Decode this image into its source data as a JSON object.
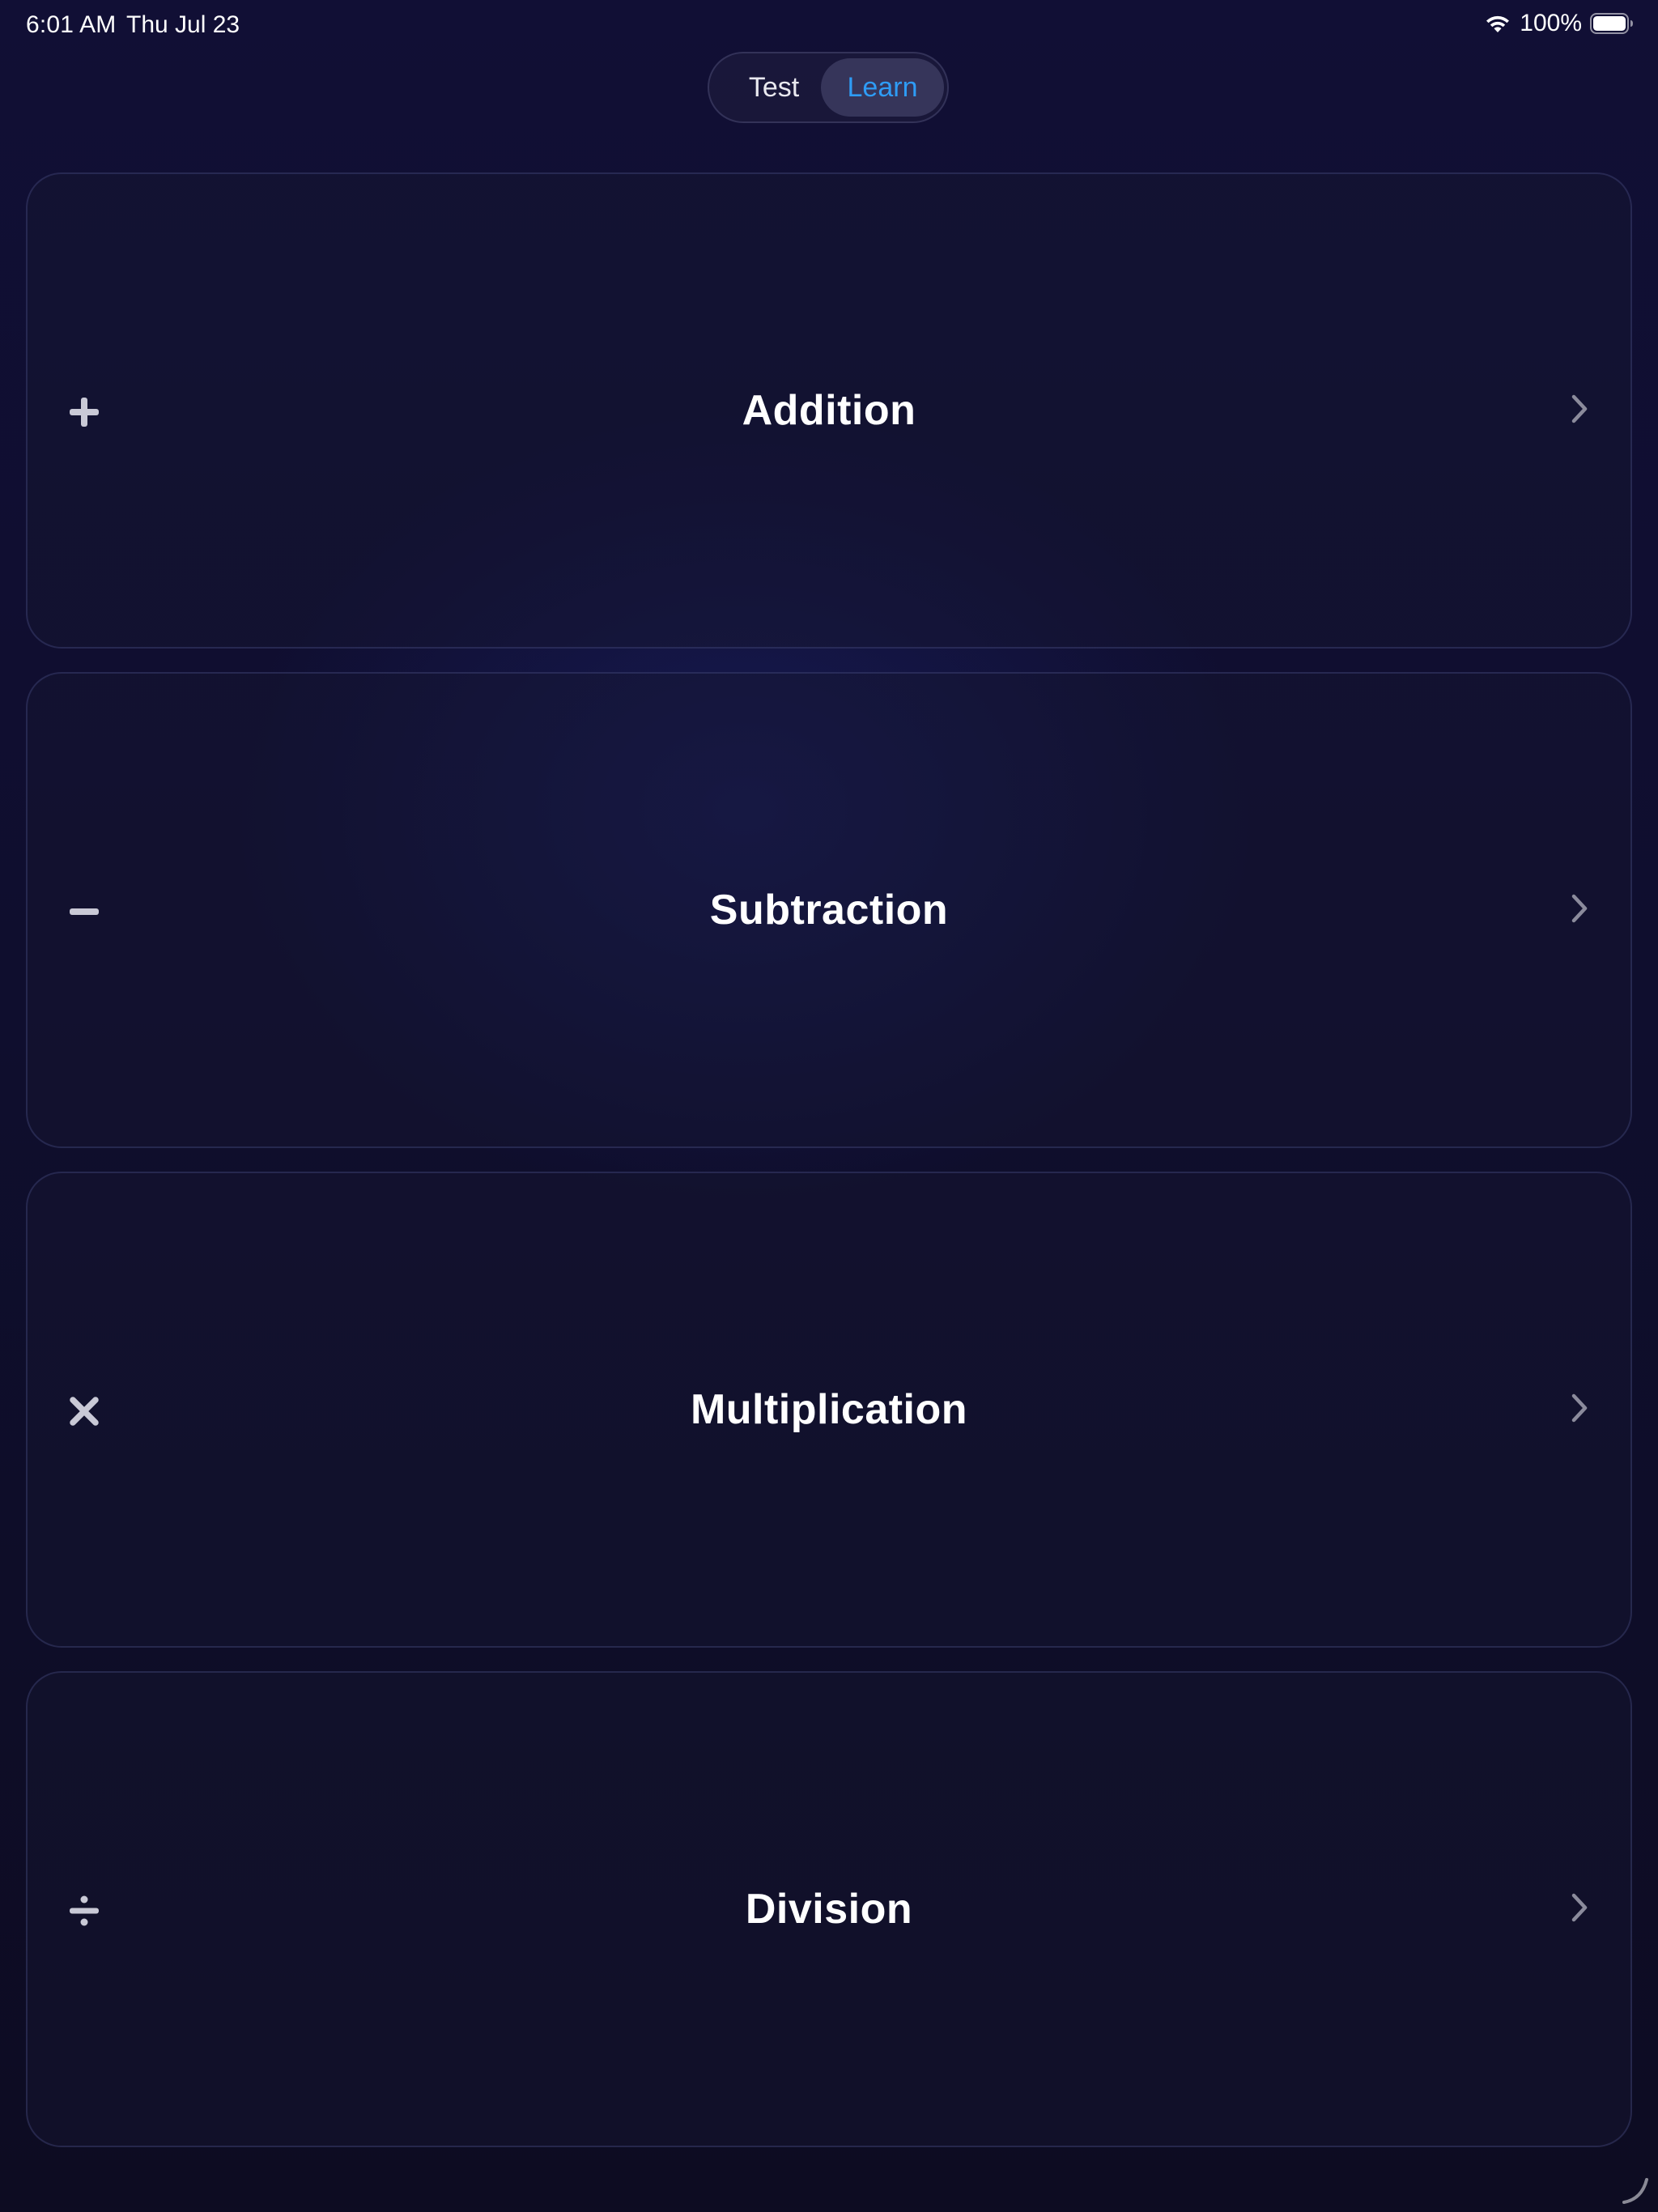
{
  "status_bar": {
    "time": "6:01 AM",
    "date": "Thu Jul 23",
    "battery_percent": "100%",
    "icons": [
      "wifi-icon",
      "battery-icon"
    ]
  },
  "mode_switch": {
    "options": [
      {
        "label": "Test",
        "selected": false
      },
      {
        "label": "Learn",
        "selected": true
      }
    ],
    "selected_color": "#2e9cf6"
  },
  "operations": [
    {
      "label": "Addition",
      "icon": "plus-icon"
    },
    {
      "label": "Subtraction",
      "icon": "minus-icon"
    },
    {
      "label": "Multiplication",
      "icon": "multiply-icon"
    },
    {
      "label": "Division",
      "icon": "divide-icon"
    }
  ],
  "colors": {
    "background": "#100f30",
    "card_border": "#3a3e78",
    "accent": "#2e9cf6",
    "icon": "#c9c9d6",
    "chevron": "#8b8b9c"
  }
}
